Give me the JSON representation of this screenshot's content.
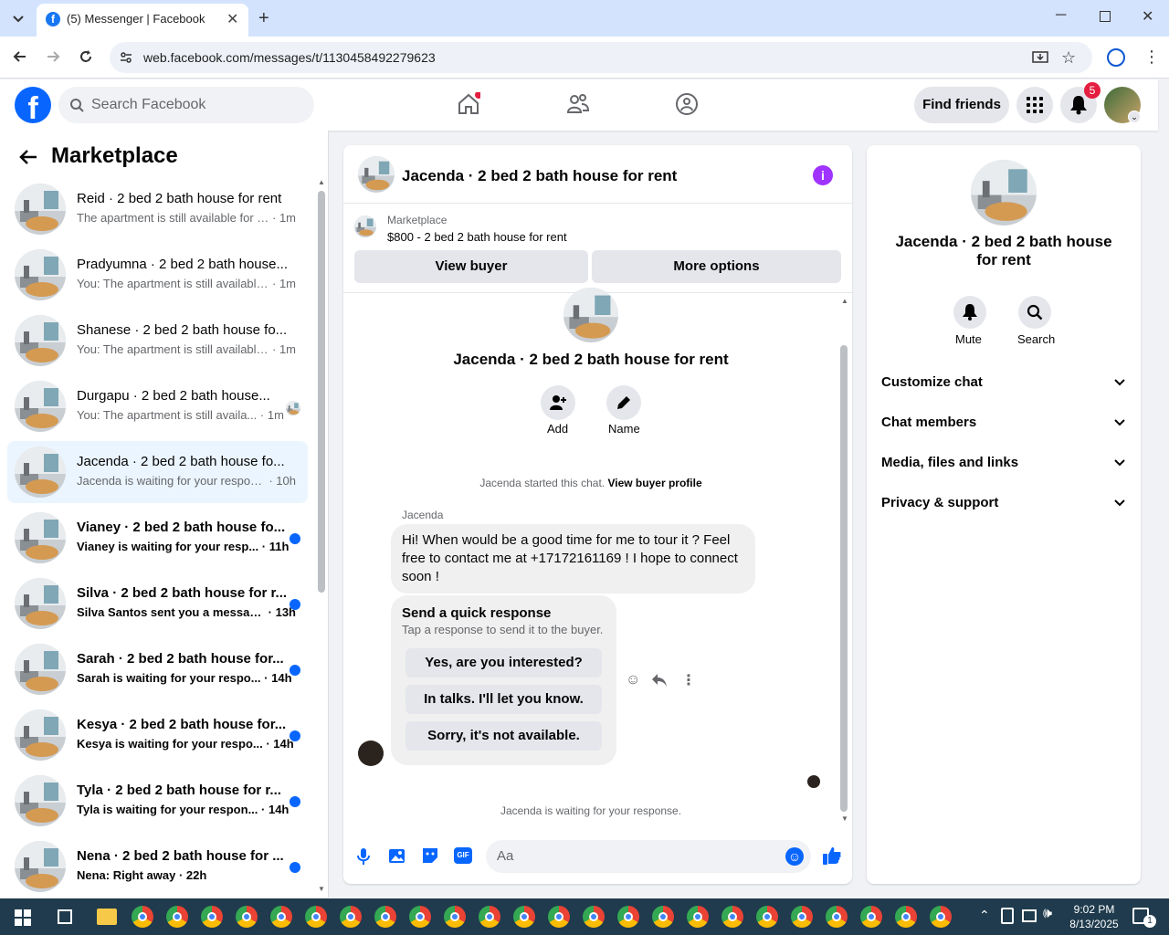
{
  "browser": {
    "tab_title": "(5) Messenger | Facebook",
    "url": "web.facebook.com/messages/t/1130458492279623"
  },
  "header": {
    "search_placeholder": "Search Facebook",
    "find_friends": "Find friends",
    "notification_count": "5"
  },
  "sidebar": {
    "title": "Marketplace",
    "conversations": [
      {
        "name": "Reid · 2 bed 2 bath house for rent",
        "preview": "The apartment is still available for r...",
        "time": "1m",
        "unread": false
      },
      {
        "name": "Pradyumna · 2 bed 2 bath house...",
        "preview": "You: The apartment is still available...",
        "time": "1m",
        "unread": false
      },
      {
        "name": "Shanese · 2 bed 2 bath house fo...",
        "preview": "You: The apartment is still available...",
        "time": "1m",
        "unread": false
      },
      {
        "name": "Durgapu · 2 bed 2 bath house...",
        "preview": "You: The apartment is still availa...",
        "time": "1m",
        "unread": false
      },
      {
        "name": "Jacenda · 2 bed 2 bath house fo...",
        "preview": "Jacenda is waiting for your respon...",
        "time": "10h",
        "unread": false
      },
      {
        "name": "Vianey · 2 bed 2 bath house fo...",
        "preview": "Vianey is waiting for your resp...",
        "time": "11h",
        "unread": true
      },
      {
        "name": "Silva · 2 bed 2 bath house for r...",
        "preview": "Silva Santos sent you a messag...",
        "time": "13h",
        "unread": true
      },
      {
        "name": "Sarah · 2 bed 2 bath house for...",
        "preview": "Sarah is waiting for your respo...",
        "time": "14h",
        "unread": true
      },
      {
        "name": "Kesya · 2 bed 2 bath house for...",
        "preview": "Kesya is waiting for your respo...",
        "time": "14h",
        "unread": true
      },
      {
        "name": "Tyla · 2 bed 2 bath house for r...",
        "preview": "Tyla is waiting for your respon...",
        "time": "14h",
        "unread": true
      },
      {
        "name": "Nena · 2 bed 2 bath house for ...",
        "preview": "Nena: Right away",
        "time": "22h",
        "unread": true
      }
    ]
  },
  "chat": {
    "title": "Jacenda · 2 bed 2 bath house for rent",
    "marketplace_label": "Marketplace",
    "listing": "$800 - 2 bed 2 bath house for rent",
    "view_buyer": "View buyer",
    "more_options": "More options",
    "intro_title": "Jacenda · 2 bed 2 bath house for rent",
    "add_label": "Add",
    "name_label": "Name",
    "started_text": "Jacenda started this chat.",
    "view_buyer_profile": "View buyer profile",
    "sender": "Jacenda",
    "message": "Hi! When would be a good time for me to tour it ? Feel free to contact me at +17172161169 ! I hope to connect soon !",
    "quick_title": "Send a quick response",
    "quick_sub": "Tap a response to send it to the buyer.",
    "quick_responses": [
      "Yes, are you interested?",
      "In talks. I'll let you know.",
      "Sorry, it's not available."
    ],
    "waiting": "Jacenda is waiting for your response.",
    "input_placeholder": "Aa"
  },
  "details": {
    "title": "Jacenda · 2 bed 2 bath house for rent",
    "mute": "Mute",
    "search": "Search",
    "sections": [
      "Customize chat",
      "Chat members",
      "Media, files and links",
      "Privacy & support"
    ]
  },
  "taskbar": {
    "time": "9:02 PM",
    "date": "8/13/2025",
    "notifications": "1"
  },
  "colors": {
    "facebook_blue": "#0866ff",
    "messenger_purple": "#a033ff",
    "badge_red": "#e41e3f"
  }
}
